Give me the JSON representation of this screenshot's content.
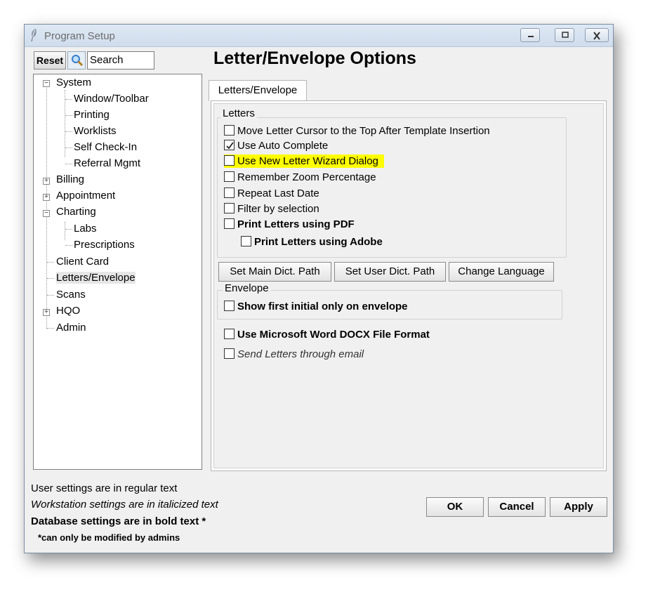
{
  "window": {
    "title": "Program Setup",
    "page_title": "Letter/Envelope Options"
  },
  "search": {
    "reset_label": "Reset",
    "value": "Search"
  },
  "tree": {
    "system": "System",
    "window_toolbar": "Window/Toolbar",
    "printing": "Printing",
    "worklists": "Worklists",
    "self_check_in": "Self Check-In",
    "referral_mgmt": "Referral Mgmt",
    "billing": "Billing",
    "appointment": "Appointment",
    "charting": "Charting",
    "labs": "Labs",
    "prescriptions": "Prescriptions",
    "client_card": "Client Card",
    "letters_envelope": "Letters/Envelope",
    "scans": "Scans",
    "hqo": "HQO",
    "admin": "Admin"
  },
  "tab": {
    "label": "Letters/Envelope"
  },
  "letters_group": {
    "title": "Letters",
    "options": [
      {
        "label": "Move Letter Cursor to the Top After Template Insertion",
        "checked": false
      },
      {
        "label": "Use Auto Complete",
        "checked": true
      },
      {
        "label": "Use New Letter Wizard Dialog",
        "checked": false,
        "highlighted": true
      },
      {
        "label": "Remember Zoom Percentage",
        "checked": false
      },
      {
        "label": "Repeat Last Date",
        "checked": false
      },
      {
        "label": "Filter by selection",
        "checked": false
      },
      {
        "label": "Print Letters using PDF",
        "checked": false
      },
      {
        "label": "Print Letters using Adobe",
        "checked": false
      }
    ]
  },
  "dict_buttons": {
    "set_main": "Set Main Dict. Path",
    "set_user": "Set User Dict. Path",
    "change_language": "Change Language"
  },
  "envelope_group": {
    "title": "Envelope",
    "show_first_initial": "Show first initial only on envelope"
  },
  "docx_option": "Use Microsoft Word DOCX File Format",
  "email_option": "Send Letters through email",
  "legend": {
    "user": "User settings are in regular text",
    "workstation": "Workstation settings are in italicized text",
    "database": "Database settings are in bold text *",
    "admin_note": "*can only be modified by admins"
  },
  "buttons": {
    "ok": "OK",
    "cancel": "Cancel",
    "apply": "Apply"
  },
  "colors": {
    "highlight": "#ffff00",
    "titlebar": "#dfe9f5"
  }
}
